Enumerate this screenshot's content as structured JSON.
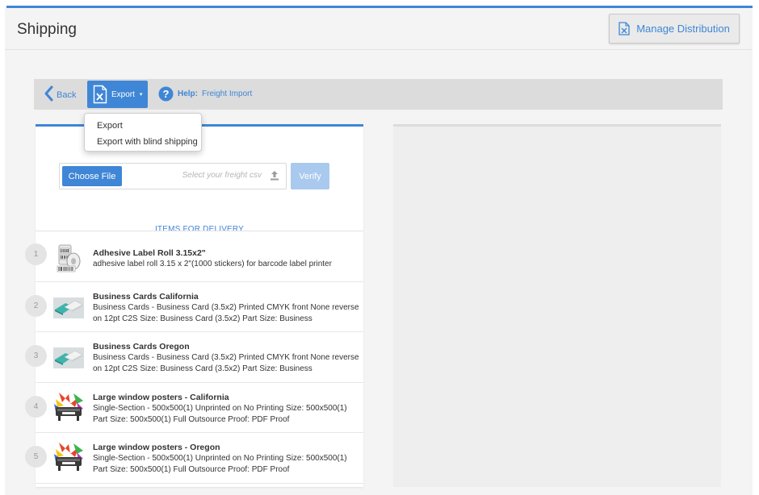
{
  "header": {
    "title": "Shipping",
    "manage_label": "Manage Distribution"
  },
  "toolbar": {
    "back_label": "Back",
    "export_label": "Export",
    "help_prefix": "Help:",
    "help_label": "Freight Import"
  },
  "export_menu": {
    "items": [
      "Export",
      "Export with blind shipping"
    ]
  },
  "upload": {
    "choose_label": "Choose File",
    "placeholder": "Select your freight csv",
    "verify_label": "Verify"
  },
  "items": {
    "header": "ITEMS FOR DELIVERY",
    "list": [
      {
        "num": "1",
        "title": "Adhesive Label Roll 3.15x2\"",
        "desc": "adhesive label roll 3.15 x 2\"(1000 stickers) for barcode label printer",
        "icon": "label-roll-icon"
      },
      {
        "num": "2",
        "title": "Business Cards California",
        "desc": "Business Cards - Business Card (3.5x2) Printed CMYK front None reverse on 12pt C2S Size: Business Card (3.5x2) Part Size: Business",
        "icon": "business-cards-icon"
      },
      {
        "num": "3",
        "title": "Business Cards Oregon",
        "desc": "Business Cards - Business Card (3.5x2) Printed CMYK front None reverse on 12pt C2S Size: Business Card (3.5x2) Part Size: Business",
        "icon": "business-cards-icon"
      },
      {
        "num": "4",
        "title": "Large window posters - California",
        "desc": "Single-Section - 500x500(1) Unprinted on No Printing Size: 500x500(1) Part Size: 500x500(1) Full Outsource Proof: PDF Proof",
        "icon": "poster-printer-icon"
      },
      {
        "num": "5",
        "title": "Large window posters - Oregon",
        "desc": "Single-Section - 500x500(1) Unprinted on No Printing Size: 500x500(1) Part Size: 500x500(1) Full Outsource Proof: PDF Proof",
        "icon": "poster-printer-icon"
      }
    ]
  },
  "colors": {
    "accent": "#3f86d6",
    "verify_disabled": "#a9c9ee",
    "background": "#f4f4f4",
    "toolbar": "#dcdcdc"
  }
}
